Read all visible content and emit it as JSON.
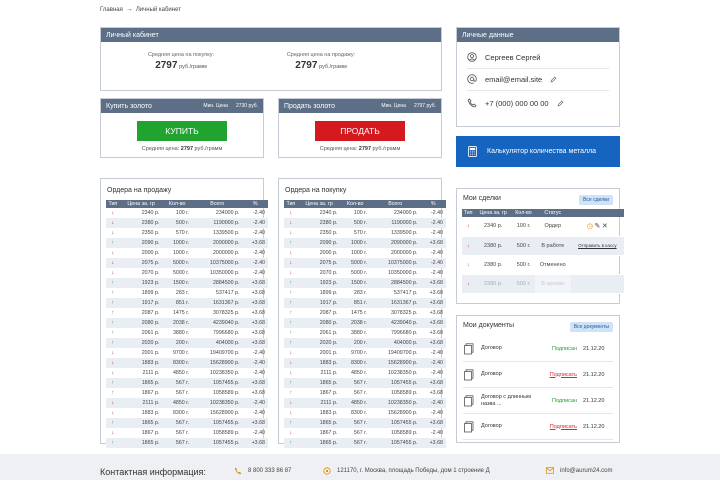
{
  "breadcrumb": {
    "home": "Главная",
    "current": "Личный кабинет"
  },
  "cabinet": {
    "title": "Личный кабинет",
    "buy_avg_label": "Средняя цена на покупку:",
    "buy_avg_value": "2797",
    "buy_avg_unit": "руб./грамм",
    "sell_avg_label": "Средняя цена на продажу:",
    "sell_avg_value": "2797",
    "sell_avg_unit": "руб./грамм"
  },
  "buy_gold": {
    "title": "Купить золото",
    "min_label": "Мин. Цена",
    "min_value": "2730 руб.",
    "button": "КУПИТЬ",
    "avg_label": "Средняя цена:",
    "avg_value": "2797",
    "avg_unit": "руб./грамм"
  },
  "sell_gold": {
    "title": "Продать золото",
    "min_label": "Мин. Цена",
    "min_value": "2797 руб.",
    "button": "ПРОДАТЬ",
    "avg_label": "Средняя цена:",
    "avg_value": "2797",
    "avg_unit": "руб./грамм"
  },
  "personal": {
    "title": "Личные данные",
    "name": "Сергеев Сергей",
    "email": "email@email.site",
    "phone": "+7 (000) 000 00 00"
  },
  "calculator": {
    "label": "Калькулятор количества металла"
  },
  "table_headers": [
    "Тип",
    "Цена за. гр",
    "Кол-во",
    "Всего",
    "%"
  ],
  "sell_orders": {
    "title": "Ордера на продажу",
    "rows": [
      {
        "dir": "down",
        "price": "2340 р.",
        "qty": "100 г.",
        "total": "234000 р.",
        "pct": "-2.40"
      },
      {
        "dir": "down",
        "price": "2380 р.",
        "qty": "500 г.",
        "total": "1190000 р.",
        "pct": "-2.40"
      },
      {
        "dir": "down",
        "price": "2350 р.",
        "qty": "570 г.",
        "total": "1339500 р.",
        "pct": "-2.40"
      },
      {
        "dir": "up",
        "price": "2090 р.",
        "qty": "1000 г.",
        "total": "2090000 р.",
        "pct": "+3.68"
      },
      {
        "dir": "down",
        "price": "2000 р.",
        "qty": "1000 г.",
        "total": "2000000 р.",
        "pct": "-2.40"
      },
      {
        "dir": "down",
        "price": "2075 р.",
        "qty": "5000 г.",
        "total": "10375000 р.",
        "pct": "-2.40"
      },
      {
        "dir": "down",
        "price": "2070 р.",
        "qty": "5000 г.",
        "total": "10350000 р.",
        "pct": "-2.40"
      },
      {
        "dir": "up",
        "price": "1923 р.",
        "qty": "1500 г.",
        "total": "2884500 р.",
        "pct": "+3.68"
      },
      {
        "dir": "up",
        "price": "1899 р.",
        "qty": "283 г.",
        "total": "537417 р.",
        "pct": "+3.68"
      },
      {
        "dir": "up",
        "price": "1917 р.",
        "qty": "851 г.",
        "total": "1631367 р.",
        "pct": "+3.68"
      },
      {
        "dir": "up",
        "price": "2087 р.",
        "qty": "1475 г.",
        "total": "3078325 р.",
        "pct": "+3.68"
      },
      {
        "dir": "up",
        "price": "2080 р.",
        "qty": "2038 г.",
        "total": "4239040 р.",
        "pct": "+3.68"
      },
      {
        "dir": "up",
        "price": "2061 р.",
        "qty": "3880 г.",
        "total": "7996680 р.",
        "pct": "+3.68"
      },
      {
        "dir": "up",
        "price": "2020 р.",
        "qty": "200 г.",
        "total": "404000 р.",
        "pct": "+3.68"
      },
      {
        "dir": "down",
        "price": "2001 р.",
        "qty": "9700 г.",
        "total": "19409700 р.",
        "pct": "-2.40"
      },
      {
        "dir": "down",
        "price": "1883 р.",
        "qty": "8300 г.",
        "total": "15628900 р.",
        "pct": "-2.40"
      },
      {
        "dir": "down",
        "price": "2111 р.",
        "qty": "4850 г.",
        "total": "10238350 р.",
        "pct": "-2.40"
      },
      {
        "dir": "up",
        "price": "1865 р.",
        "qty": "567 г.",
        "total": "1057455 р.",
        "pct": "+3.68"
      },
      {
        "dir": "up",
        "price": "1867 р.",
        "qty": "567 г.",
        "total": "1058589 р.",
        "pct": "+3.68"
      },
      {
        "dir": "down",
        "price": "2111 р.",
        "qty": "4850 г.",
        "total": "10238350 р.",
        "pct": "-2.40"
      },
      {
        "dir": "down",
        "price": "1883 р.",
        "qty": "8300 г.",
        "total": "15628900 р.",
        "pct": "-2.40"
      },
      {
        "dir": "up",
        "price": "1865 р.",
        "qty": "567 г.",
        "total": "1057455 р.",
        "pct": "+3.68"
      },
      {
        "dir": "down",
        "price": "1867 р.",
        "qty": "567 г.",
        "total": "1058589 р.",
        "pct": "-2.40"
      },
      {
        "dir": "up",
        "price": "1865 р.",
        "qty": "567 г.",
        "total": "1057455 р.",
        "pct": "+3.68"
      }
    ]
  },
  "buy_orders": {
    "title": "Ордера на покупку",
    "rows": [
      {
        "dir": "down",
        "price": "2340 р.",
        "qty": "100 г.",
        "total": "234000 р.",
        "pct": "-2.40"
      },
      {
        "dir": "down",
        "price": "2380 р.",
        "qty": "500 г.",
        "total": "1190000 р.",
        "pct": "-2.40"
      },
      {
        "dir": "down",
        "price": "2350 р.",
        "qty": "570 г.",
        "total": "1339500 р.",
        "pct": "-2.40"
      },
      {
        "dir": "up",
        "price": "2090 р.",
        "qty": "1000 г.",
        "total": "2090000 р.",
        "pct": "+3.68"
      },
      {
        "dir": "down",
        "price": "2000 р.",
        "qty": "1000 г.",
        "total": "2000000 р.",
        "pct": "-2.40"
      },
      {
        "dir": "down",
        "price": "2075 р.",
        "qty": "5000 г.",
        "total": "10375000 р.",
        "pct": "-2.40"
      },
      {
        "dir": "down",
        "price": "2070 р.",
        "qty": "5000 г.",
        "total": "10350000 р.",
        "pct": "-2.40"
      },
      {
        "dir": "up",
        "price": "1923 р.",
        "qty": "1500 г.",
        "total": "2884500 р.",
        "pct": "+3.68"
      },
      {
        "dir": "up",
        "price": "1899 р.",
        "qty": "283 г.",
        "total": "537417 р.",
        "pct": "+3.68"
      },
      {
        "dir": "up",
        "price": "1917 р.",
        "qty": "851 г.",
        "total": "1631367 р.",
        "pct": "+3.68"
      },
      {
        "dir": "up",
        "price": "2087 р.",
        "qty": "1475 г.",
        "total": "3078325 р.",
        "pct": "+3.68"
      },
      {
        "dir": "up",
        "price": "2080 р.",
        "qty": "2038 г.",
        "total": "4239040 р.",
        "pct": "+3.68"
      },
      {
        "dir": "up",
        "price": "2061 р.",
        "qty": "3880 г.",
        "total": "7996680 р.",
        "pct": "+3.68"
      },
      {
        "dir": "up",
        "price": "2020 р.",
        "qty": "200 г.",
        "total": "404000 р.",
        "pct": "+3.68"
      },
      {
        "dir": "down",
        "price": "2001 р.",
        "qty": "9700 г.",
        "total": "19409700 р.",
        "pct": "-2.40"
      },
      {
        "dir": "down",
        "price": "1883 р.",
        "qty": "8300 г.",
        "total": "15628900 р.",
        "pct": "-2.40"
      },
      {
        "dir": "down",
        "price": "2111 р.",
        "qty": "4850 г.",
        "total": "10238350 р.",
        "pct": "-2.40"
      },
      {
        "dir": "up",
        "price": "1865 р.",
        "qty": "567 г.",
        "total": "1057455 р.",
        "pct": "+3.68"
      },
      {
        "dir": "up",
        "price": "1867 р.",
        "qty": "567 г.",
        "total": "1058589 р.",
        "pct": "+3.68"
      },
      {
        "dir": "down",
        "price": "2111 р.",
        "qty": "4850 г.",
        "total": "10238350 р.",
        "pct": "-2.40"
      },
      {
        "dir": "down",
        "price": "1883 р.",
        "qty": "8300 г.",
        "total": "15628900 р.",
        "pct": "-2.40"
      },
      {
        "dir": "up",
        "price": "1865 р.",
        "qty": "567 г.",
        "total": "1057455 р.",
        "pct": "+3.68"
      },
      {
        "dir": "down",
        "price": "1867 р.",
        "qty": "567 г.",
        "total": "1058589 р.",
        "pct": "-2.40"
      },
      {
        "dir": "up",
        "price": "1865 р.",
        "qty": "567 г.",
        "total": "1057455 р.",
        "pct": "+3.68"
      }
    ]
  },
  "deals": {
    "title": "Мои сделки",
    "all_link": "Все сделки",
    "headers": [
      "Тип",
      "Цена за. гр",
      "Кол-во",
      "Статус"
    ],
    "rows": [
      {
        "dir": "down",
        "price": "2340 р.",
        "qty": "100 г.",
        "status": "Ордер",
        "status_class": "st-order",
        "extra": "icons",
        "grey": false,
        "faded": false
      },
      {
        "dir": "down",
        "price": "2380 р.",
        "qty": "500 г.",
        "status": "В работе",
        "status_class": "st-work",
        "extra": "Отправить в кассу",
        "grey": true,
        "faded": false
      },
      {
        "dir": "down",
        "price": "2380 р.",
        "qty": "500 г.",
        "status": "Отменено",
        "status_class": "st-cancel",
        "extra": "",
        "grey": false,
        "faded": false
      },
      {
        "dir": "down",
        "price": "2380 р.",
        "qty": "500 г.",
        "status": "В архиве",
        "status_class": "st-archive",
        "extra": "",
        "grey": true,
        "faded": true
      }
    ]
  },
  "documents": {
    "title": "Мои документы",
    "all_link": "Все документы",
    "rows": [
      {
        "name": "Договор",
        "status": "Подписан",
        "signed": true,
        "date": "21.12.20"
      },
      {
        "name": "Договор",
        "status": "Подписать",
        "signed": false,
        "date": "21.12.20"
      },
      {
        "name": "Договор с длинным назва ...",
        "status": "Подписан",
        "signed": true,
        "date": "21.12.20"
      },
      {
        "name": "Договор",
        "status": "Подписать",
        "signed": false,
        "date": "21.12.20"
      }
    ]
  },
  "footer": {
    "title": "Контактная информация:",
    "phone": "8 800 333 86 87",
    "address": "121170, г. Москва, площадь Победы, дом 1 строение Д",
    "email": "info@aurum24.com"
  },
  "colors": {
    "header": "#5c6f87",
    "accent": "#1565c0",
    "buy": "#21a32f",
    "sell": "#d41a1f"
  }
}
